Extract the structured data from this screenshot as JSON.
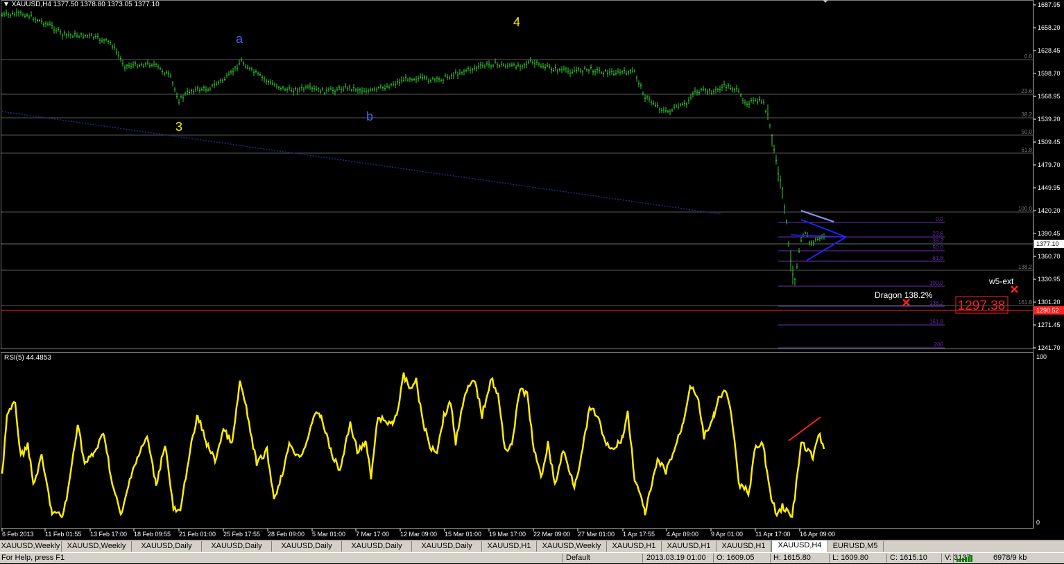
{
  "window": {
    "title": "XAUUSD,H4  1377.50 1378.80 1373.05 1377.10"
  },
  "price_axis": {
    "labels": [
      "1687.95",
      "1658.20",
      "1628.45",
      "1598.70",
      "1568.95",
      "1539.20",
      "1509.45",
      "1479.70",
      "1449.95",
      "1420.20",
      "1390.45",
      "1360.70",
      "1330.95",
      "1301.20",
      "1271.45",
      "1241.70"
    ],
    "current_price": "1377.10",
    "red_level": "1290.52"
  },
  "rsi": {
    "title": "RSI(5) 44.4853",
    "axis_max": "100",
    "axis_min": "0"
  },
  "time_axis": {
    "labels": [
      "6 Feb 2013",
      "11 Feb 01:55",
      "13 Feb 17:00",
      "18 Feb 09:55",
      "21 Feb 01:00",
      "25 Feb 17:55",
      "28 Feb 09:00",
      "5 Mar 01:00",
      "7 Mar 17:00",
      "12 Mar 09:00",
      "15 Mar 01:00",
      "19 Mar 17:00",
      "22 Mar 09:00",
      "27 Mar 01:00",
      "1 Apr 17:55",
      "4 Apr 09:00",
      "9 Apr 01:00",
      "11 Apr 17:00",
      "16 Apr 09:00"
    ]
  },
  "wave_labels": {
    "w3": "3",
    "w4": "4",
    "wa": "a",
    "wb": "b"
  },
  "annotations": {
    "w5_ext": "w5-ext",
    "dragon": "Dragon 138.2%",
    "target_box": "1297.38"
  },
  "fib_big": [
    "0.0",
    "23.6",
    "38.2",
    "50.0",
    "61.8",
    "100.0",
    "138.2",
    "161.8"
  ],
  "fib_small": [
    "0.0",
    "23.6",
    "38.2",
    "50.0",
    "61.8",
    "100.0",
    "138.2",
    "161.8",
    "200"
  ],
  "tabs": [
    {
      "label": "XAUUSD,Weekly",
      "active": false
    },
    {
      "label": "XAUUSD,Weekly",
      "active": false
    },
    {
      "label": "XAUUSD,Daily",
      "active": false
    },
    {
      "label": "XAUUSD,Daily",
      "active": false
    },
    {
      "label": "XAUUSD,Daily",
      "active": false
    },
    {
      "label": "XAUUSD,Daily",
      "active": false
    },
    {
      "label": "XAUUSD,Daily",
      "active": false
    },
    {
      "label": "XAUUSD,H1",
      "active": false
    },
    {
      "label": "XAUUSD,Weekly",
      "active": false
    },
    {
      "label": "XAUUSD,H1",
      "active": false
    },
    {
      "label": "XAUUSD,H1",
      "active": false
    },
    {
      "label": "XAUUSD,H1",
      "active": false
    },
    {
      "label": "XAUUSD,H4",
      "active": true
    },
    {
      "label": "EURUSD,M5",
      "active": false
    }
  ],
  "status_bar": {
    "help": "For Help, press F1",
    "profile": "Default",
    "datetime": "2013.03.19 01:00",
    "open": "O: 1609.05",
    "high": "H: 1615.80",
    "low": "L: 1609.80",
    "close": "C: 1615.10",
    "volume": "V: 3137",
    "traffic": "6978/9 kb"
  },
  "colors": {
    "background": "#000000",
    "candle": "#33cc33",
    "grid": "#5a5a5a",
    "rsi_line": "#ffee00",
    "wave_yellow": "#ffee00",
    "wave_blue": "#4466ee",
    "fib_purple": "#6b2fb0",
    "triangle": "#2222ff",
    "red": "#ff2020"
  }
}
